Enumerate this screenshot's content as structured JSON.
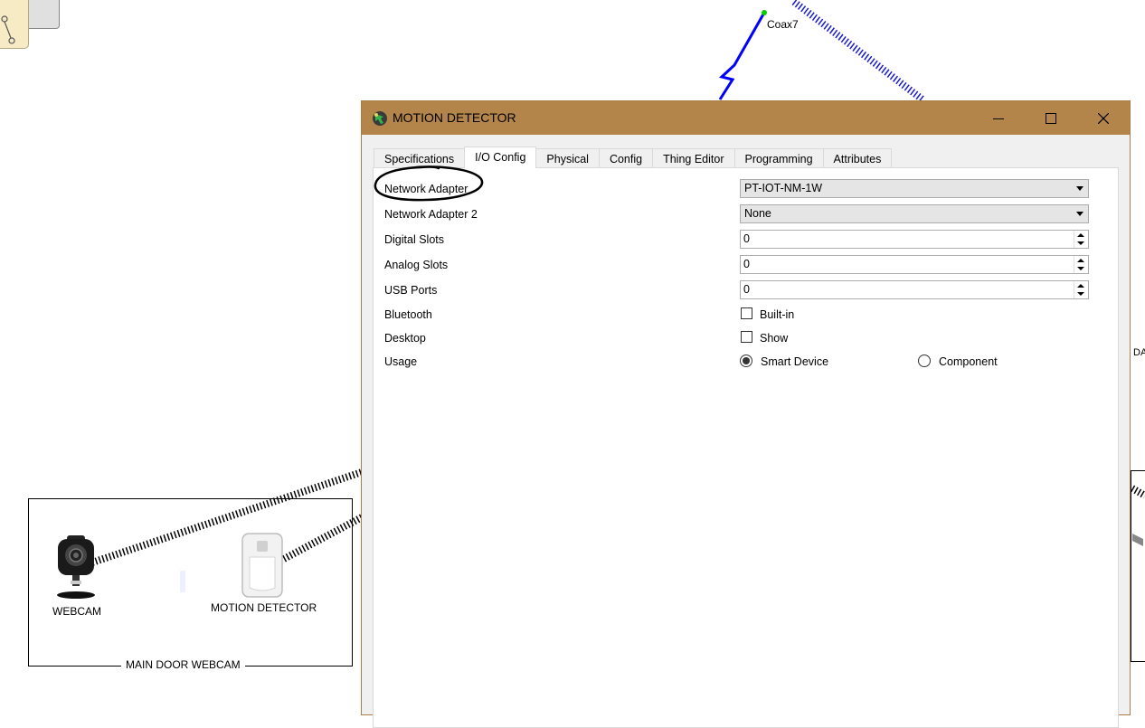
{
  "workspace": {
    "link_label": "Coax7",
    "cluster_label": "MAIN DOOR WEBCAM",
    "devices": [
      {
        "label": "WEBCAM",
        "icon": "webcam-icon"
      },
      {
        "label": "MOTION DETECTOR",
        "icon": "motion-detector-icon"
      }
    ],
    "right_edge_text": "DA"
  },
  "dialog": {
    "title": "MOTION DETECTOR",
    "title_icon": "motion-detector-icon",
    "controls": {
      "minimize": "minimize-icon",
      "maximize": "maximize-icon",
      "close": "close-icon"
    },
    "tabs": [
      {
        "label": "Specifications"
      },
      {
        "label": "I/O Config",
        "active": true
      },
      {
        "label": "Physical"
      },
      {
        "label": "Config"
      },
      {
        "label": "Thing Editor"
      },
      {
        "label": "Programming"
      },
      {
        "label": "Attributes"
      }
    ],
    "io_config": {
      "network_adapter": {
        "label": "Network Adapter",
        "value": "PT-IOT-NM-1W"
      },
      "network_adapter_2": {
        "label": "Network Adapter 2",
        "value": "None"
      },
      "digital_slots": {
        "label": "Digital Slots",
        "value": "0"
      },
      "analog_slots": {
        "label": "Analog Slots",
        "value": "0"
      },
      "usb_ports": {
        "label": "USB Ports",
        "value": "0"
      },
      "bluetooth": {
        "label": "Bluetooth",
        "option": "Built-in",
        "checked": false
      },
      "desktop": {
        "label": "Desktop",
        "option": "Show",
        "checked": false
      },
      "usage": {
        "label": "Usage",
        "options": [
          {
            "label": "Smart Device",
            "selected": true
          },
          {
            "label": "Component",
            "selected": false
          }
        ]
      }
    }
  },
  "colors": {
    "titlebar": "#b3854a",
    "coax_link": "#0000ff",
    "wireless_link": "#000000",
    "wireless_link_blue": "#1a1acc"
  }
}
